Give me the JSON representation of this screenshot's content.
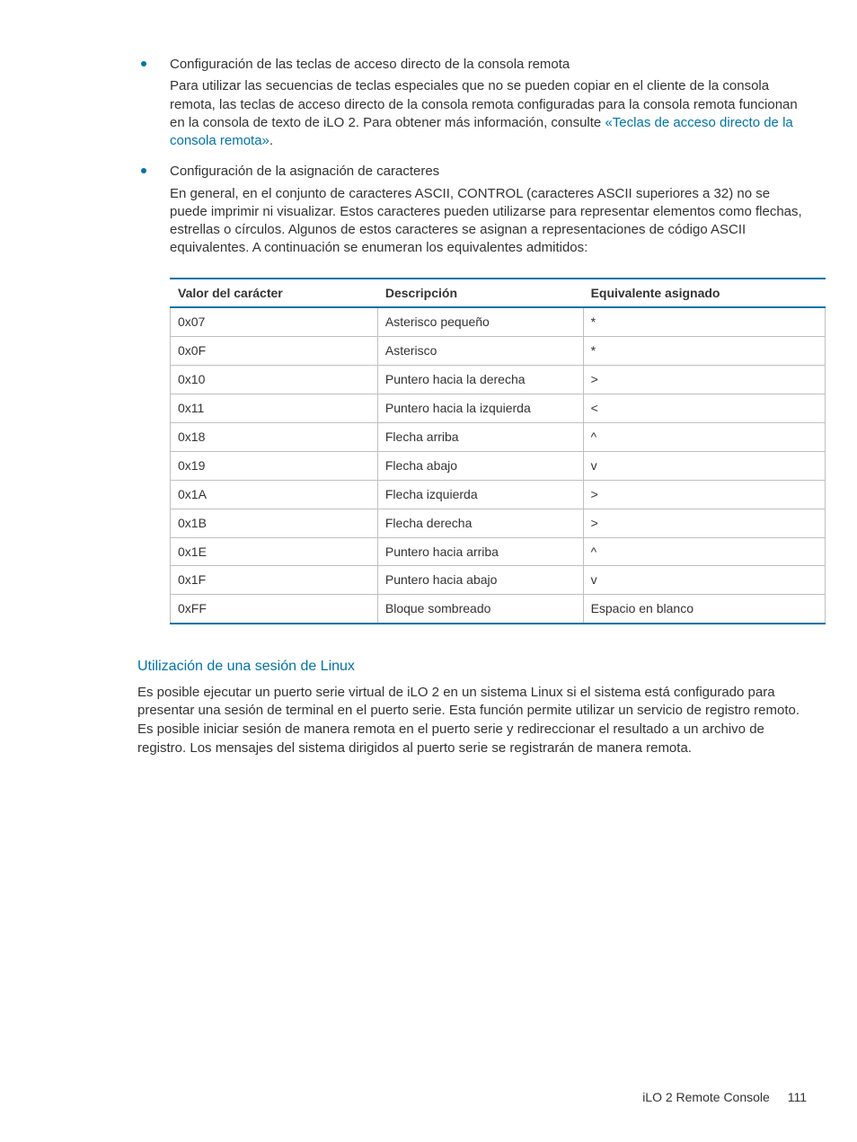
{
  "bullets": [
    {
      "title": "Configuración de las teclas de acceso directo de la consola remota",
      "body_before_link": "Para utilizar las secuencias de teclas especiales que no se pueden copiar en el cliente de la consola remota, las teclas de acceso directo de la consola remota configuradas para la consola remota funcionan en la consola de texto de iLO 2. Para obtener más información, consulte ",
      "link_text": "«Teclas de acceso directo de la consola remota»",
      "body_after_link": "."
    },
    {
      "title": "Configuración de la asignación de caracteres",
      "body_before_link": "En general, en el conjunto de caracteres ASCII, CONTROL (caracteres ASCII superiores a 32) no se puede imprimir ni visualizar. Estos caracteres pueden utilizarse para representar elementos como flechas, estrellas o círculos. Algunos de estos caracteres se asignan a representaciones de código ASCII equivalentes. A continuación se enumeran los equivalentes admitidos:",
      "link_text": "",
      "body_after_link": ""
    }
  ],
  "table": {
    "headers": [
      "Valor del carácter",
      "Descripción",
      "Equivalente asignado"
    ],
    "rows": [
      [
        "0x07",
        "Asterisco pequeño",
        "*"
      ],
      [
        "0x0F",
        "Asterisco",
        "*"
      ],
      [
        "0x10",
        "Puntero hacia la derecha",
        ">"
      ],
      [
        "0x11",
        "Puntero hacia la izquierda",
        "<"
      ],
      [
        "0x18",
        "Flecha arriba",
        "^"
      ],
      [
        "0x19",
        "Flecha abajo",
        "v"
      ],
      [
        "0x1A",
        "Flecha izquierda",
        ">"
      ],
      [
        "0x1B",
        "Flecha derecha",
        ">"
      ],
      [
        "0x1E",
        "Puntero hacia arriba",
        "^"
      ],
      [
        "0x1F",
        "Puntero hacia abajo",
        "v"
      ],
      [
        "0xFF",
        "Bloque sombreado",
        "Espacio en blanco"
      ]
    ]
  },
  "section": {
    "heading": "Utilización de una sesión de Linux",
    "body": "Es posible ejecutar un puerto serie virtual de iLO 2 en un sistema Linux si el sistema está configurado para presentar una sesión de terminal en el puerto serie. Esta función permite utilizar un servicio de registro remoto. Es posible iniciar sesión de manera remota en el puerto serie y redireccionar el resultado a un archivo de registro. Los mensajes del sistema dirigidos al puerto serie se registrarán de manera remota."
  },
  "footer": {
    "text": "iLO 2 Remote Console",
    "page": "111"
  }
}
